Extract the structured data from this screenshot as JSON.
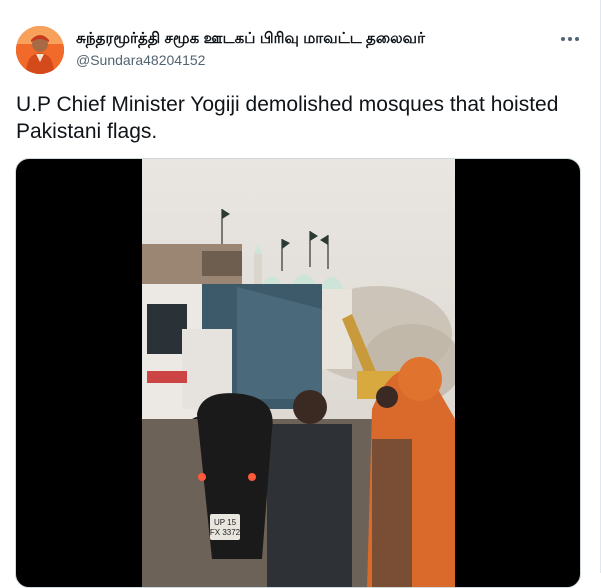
{
  "tweet": {
    "author": {
      "display_name": "சுந்தரமூர்த்தி சமூக ஊடகப் பிரிவு மாவட்ட தலைவர்",
      "handle": "@Sundara48204152",
      "avatar_icon": "avatar-photo-icon"
    },
    "more_icon": "more-horizontal-icon",
    "text": "U.P Chief Minister Yogiji demolished mosques that hoisted Pakistani flags.",
    "media": {
      "type": "video",
      "plate_text": "UP 15\nFX 3372"
    }
  },
  "colors": {
    "text_primary": "#0f1419",
    "text_secondary": "#536471",
    "media_background": "#000000",
    "avatar_background": "#e8531f"
  }
}
